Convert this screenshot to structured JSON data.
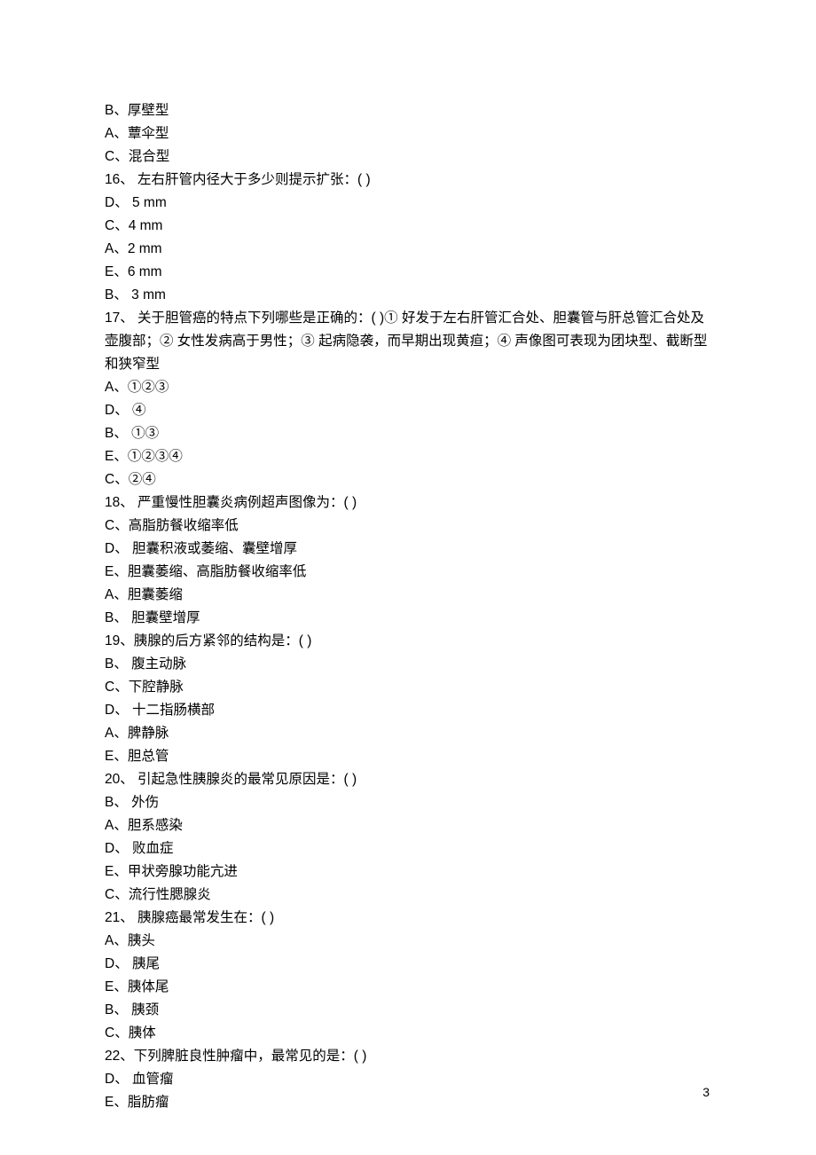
{
  "lines": {
    "l0": "B、厚壁型",
    "l1": "A、蕈伞型",
    "l2": "C、混合型",
    "l3": "16、 左右肝管内径大于多少则提示扩张：( )",
    "l4": "D、 5 mm",
    "l5": "C、4 mm",
    "l6": "A、2 mm",
    "l7": "E、6 mm",
    "l8": "B、 3 mm",
    "l9": "17、 关于胆管癌的特点下列哪些是正确的：( )① 好发于左右肝管汇合处、胆囊管与肝总管汇合处及壶腹部；② 女性发病高于男性；③ 起病隐袭，而早期出现黄疸；④ 声像图可表现为团块型、截断型和狭窄型",
    "l10": "A、①②③",
    "l11": "D、 ④",
    "l12": "B、 ①③",
    "l13": "E、①②③④",
    "l14": "C、②④",
    "l15": "18、 严重慢性胆囊炎病例超声图像为：( )",
    "l16": "C、高脂肪餐收缩率低",
    "l17": "D、 胆囊积液或萎缩、囊壁增厚",
    "l18": "E、胆囊萎缩、高脂肪餐收缩率低",
    "l19": "A、胆囊萎缩",
    "l20": "B、 胆囊壁增厚",
    "l21": "19、胰腺的后方紧邻的结构是：( )",
    "l22": "B、 腹主动脉",
    "l23": "C、下腔静脉",
    "l24": "D、 十二指肠横部",
    "l25": "A、脾静脉",
    "l26": "E、胆总管",
    "l27": "20、 引起急性胰腺炎的最常见原因是：( )",
    "l28": "B、 外伤",
    "l29": "A、胆系感染",
    "l30": "D、 败血症",
    "l31": "E、甲状旁腺功能亢进",
    "l32": "C、流行性腮腺炎",
    "l33": "21、 胰腺癌最常发生在：( )",
    "l34": "A、胰头",
    "l35": "D、 胰尾",
    "l36": "E、胰体尾",
    "l37": "B、 胰颈",
    "l38": "C、胰体",
    "l39": "22、下列脾脏良性肿瘤中，最常见的是：( )",
    "l40": "D、 血管瘤",
    "l41": "E、脂肪瘤"
  },
  "pageNumber": "3"
}
